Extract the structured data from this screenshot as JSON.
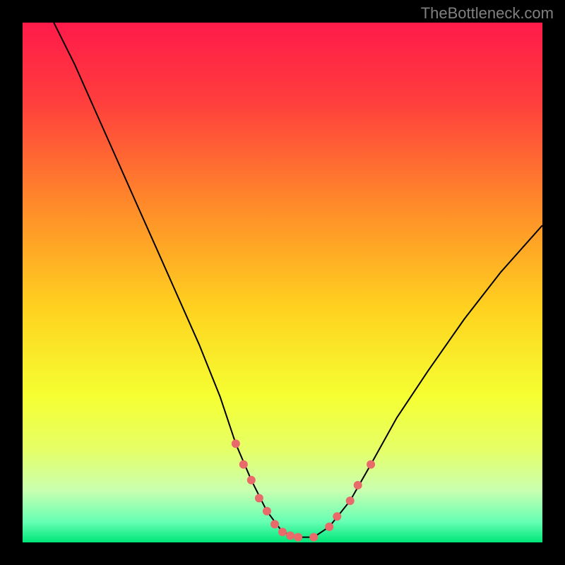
{
  "watermark": "TheBottleneck.com",
  "chart_data": {
    "type": "line",
    "title": "",
    "xlabel": "",
    "ylabel": "",
    "xlim": [
      0,
      100
    ],
    "ylim": [
      0,
      100
    ],
    "gradient_stops": [
      {
        "offset": 0,
        "color": "#ff1a4a"
      },
      {
        "offset": 0.15,
        "color": "#ff3d3d"
      },
      {
        "offset": 0.35,
        "color": "#ff8a2a"
      },
      {
        "offset": 0.55,
        "color": "#ffd21f"
      },
      {
        "offset": 0.72,
        "color": "#f5ff32"
      },
      {
        "offset": 0.82,
        "color": "#e6ff66"
      },
      {
        "offset": 0.9,
        "color": "#c9ffb0"
      },
      {
        "offset": 0.96,
        "color": "#66ffb3"
      },
      {
        "offset": 1.0,
        "color": "#00e67a"
      }
    ],
    "series": [
      {
        "name": "curve",
        "x": [
          6,
          10,
          14,
          18,
          22,
          26,
          30,
          34,
          38,
          41,
          44,
          47,
          50,
          53,
          56,
          59,
          63,
          67,
          72,
          78,
          85,
          92,
          100
        ],
        "y": [
          100,
          92,
          83,
          74,
          65,
          56,
          47,
          38,
          28,
          19,
          12,
          6,
          2,
          1,
          1,
          3,
          8,
          15,
          24,
          33,
          43,
          52,
          61
        ]
      }
    ],
    "markers": {
      "name": "dots",
      "color": "#e96a6a",
      "x": [
        41,
        42.5,
        44,
        45.5,
        47,
        48.5,
        50,
        51.5,
        53,
        56,
        59,
        60.5,
        63,
        64.5,
        67
      ],
      "y": [
        19,
        15,
        12,
        8.5,
        6,
        3.5,
        2,
        1.3,
        1,
        1,
        3,
        5,
        8,
        11,
        15
      ]
    }
  }
}
